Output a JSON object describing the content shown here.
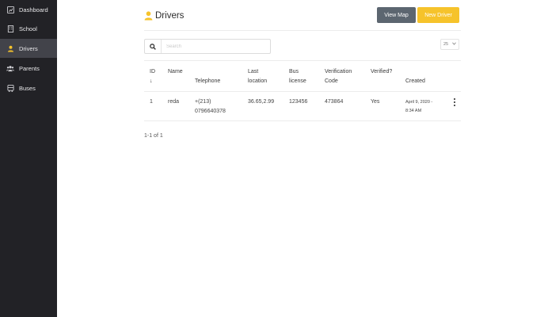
{
  "sidebar": {
    "items": [
      {
        "label": "Dashboard",
        "icon": "dashboard-icon"
      },
      {
        "label": "School",
        "icon": "building-icon"
      },
      {
        "label": "Drivers",
        "icon": "person-icon",
        "active": true
      },
      {
        "label": "Parents",
        "icon": "people-icon"
      },
      {
        "label": "Buses",
        "icon": "bus-icon"
      }
    ]
  },
  "header": {
    "title": "Drivers",
    "view_map_label": "View Map",
    "new_driver_label": "New Driver"
  },
  "search": {
    "placeholder": "Search",
    "value": ""
  },
  "per_page": "25",
  "table": {
    "sort_indicator": "↓",
    "columns": [
      "ID",
      "Name",
      "Telephone",
      "Last location",
      "Bus license",
      "Verification Code",
      "Verified?",
      "Created"
    ],
    "rows": [
      {
        "id": "1",
        "name": "reda",
        "telephone": "+(213) 0796640378",
        "last_location": "36.65,2.99",
        "bus_license": "123456",
        "verification_code": "473864",
        "verified": "Yes",
        "created": "April 9, 2020 - 8:34 AM"
      }
    ]
  },
  "pagination": {
    "summary": "1-1 of 1"
  },
  "colors": {
    "sidebar_bg": "#222226",
    "sidebar_active": "#42434a",
    "accent": "#f6c32b",
    "secondary_button": "#5c6670"
  }
}
